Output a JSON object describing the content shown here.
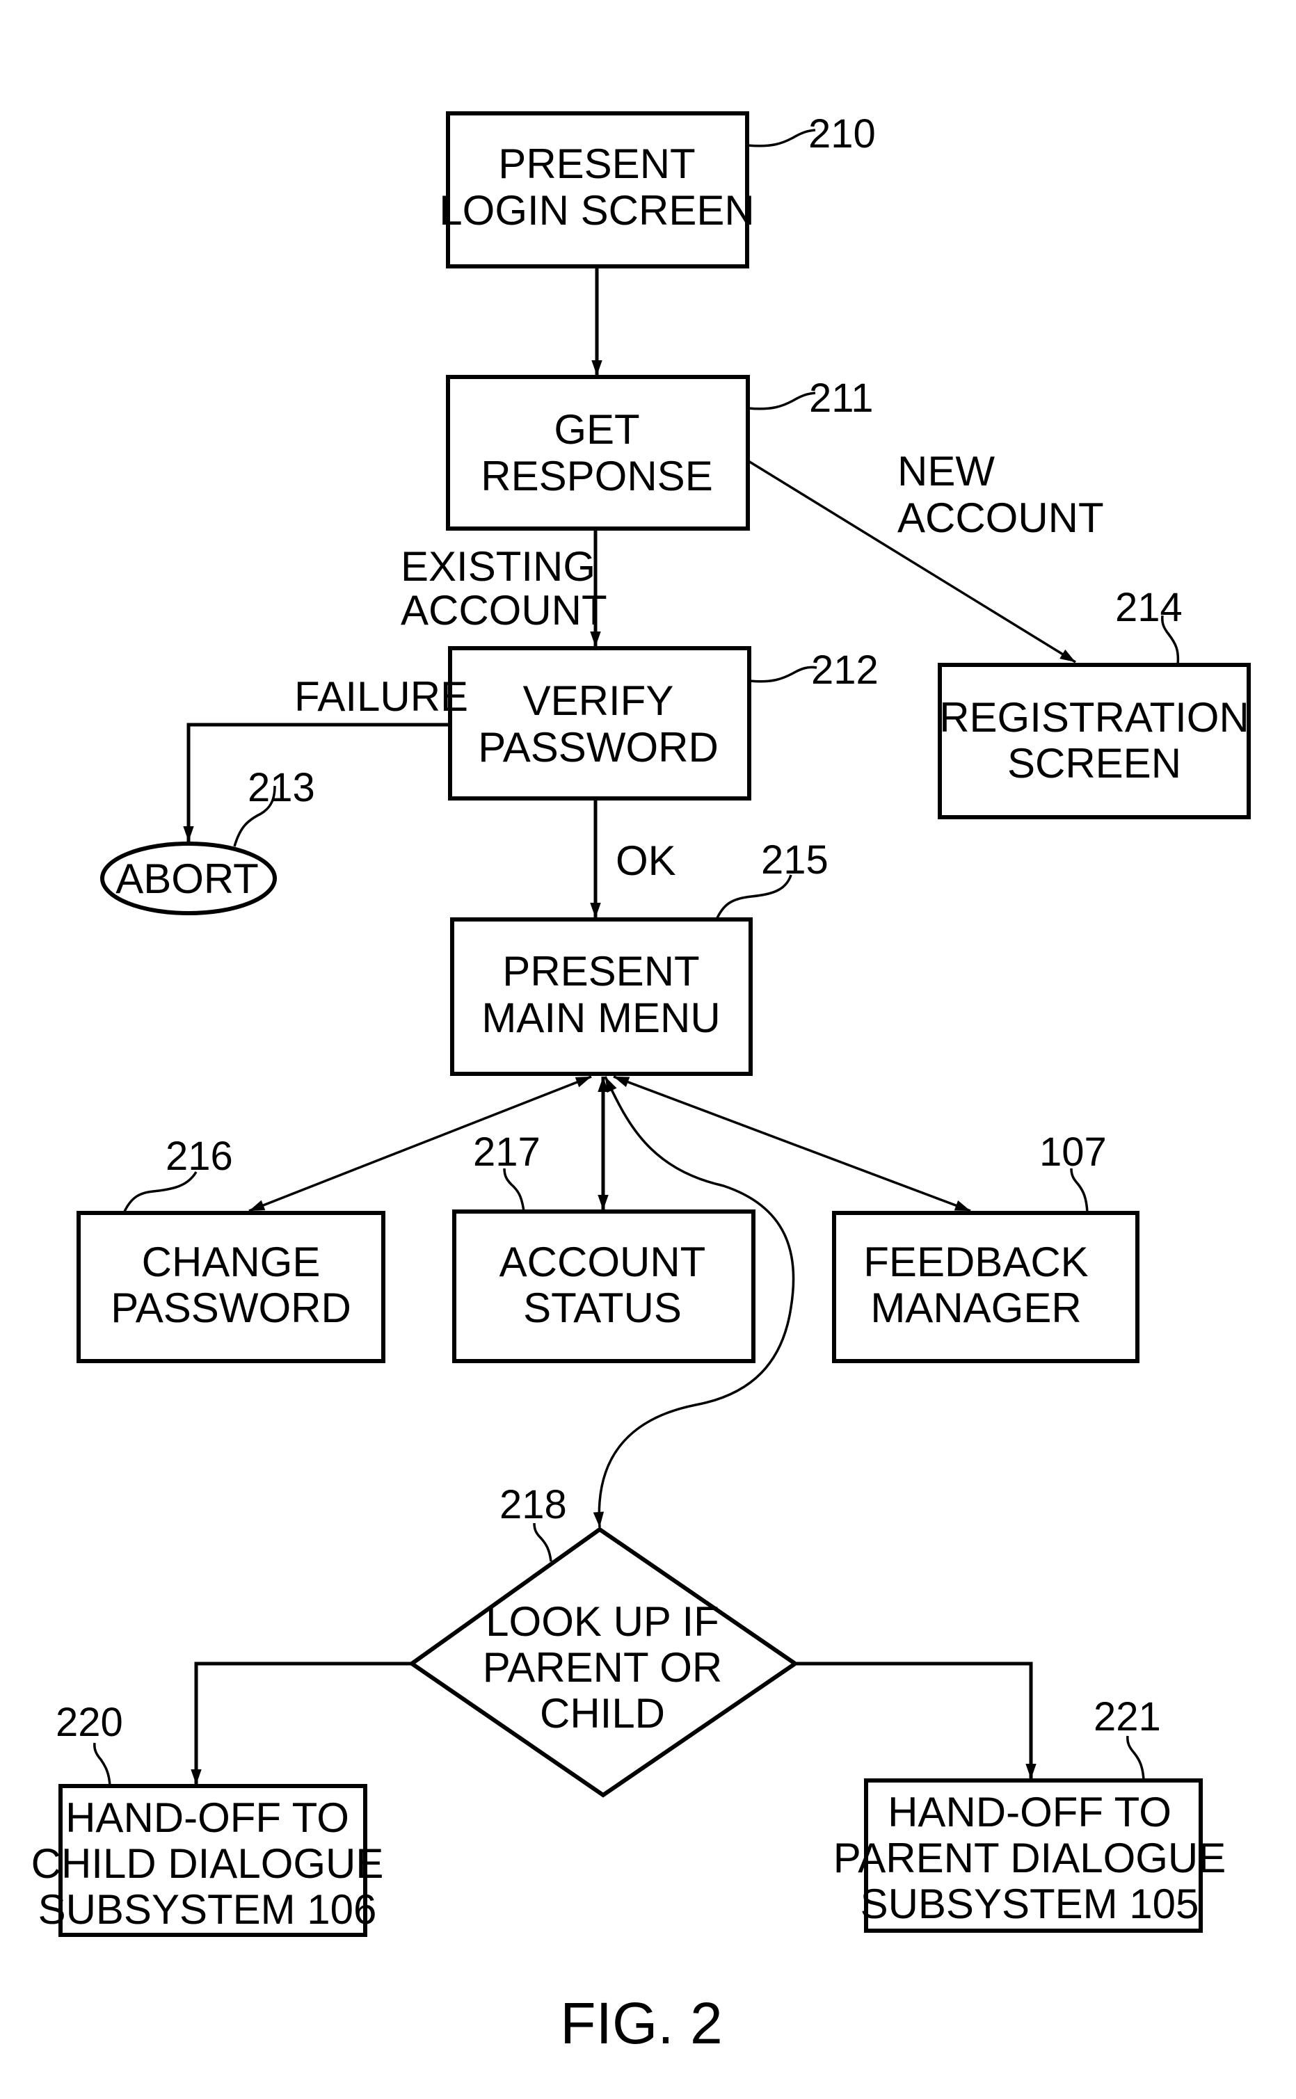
{
  "figure_title": "FIG. 2",
  "nodes": {
    "present_login": {
      "ref": "210",
      "lines": [
        "PRESENT",
        "LOGIN SCREEN"
      ]
    },
    "get_response": {
      "ref": "211",
      "lines": [
        "GET",
        "RESPONSE"
      ]
    },
    "verify_password": {
      "ref": "212",
      "lines": [
        "VERIFY",
        "PASSWORD"
      ]
    },
    "abort": {
      "ref": "213",
      "lines": [
        "ABORT"
      ]
    },
    "registration_screen": {
      "ref": "214",
      "lines": [
        "REGISTRATION",
        "SCREEN"
      ]
    },
    "present_main_menu": {
      "ref": "215",
      "lines": [
        "PRESENT",
        "MAIN MENU"
      ]
    },
    "change_password": {
      "ref": "216",
      "lines": [
        "CHANGE",
        "PASSWORD"
      ]
    },
    "account_status": {
      "ref": "217",
      "lines": [
        "ACCOUNT",
        "STATUS"
      ]
    },
    "feedback_manager": {
      "ref": "107",
      "lines": [
        "FEEDBACK",
        "MANAGER"
      ]
    },
    "lookup_parent_child": {
      "ref": "218",
      "lines": [
        "LOOK UP IF",
        "PARENT OR",
        "CHILD"
      ]
    },
    "handoff_child": {
      "ref": "220",
      "lines": [
        "HAND-OFF TO",
        "CHILD DIALOGUE",
        "SUBSYSTEM 106"
      ]
    },
    "handoff_parent": {
      "ref": "221",
      "lines": [
        "HAND-OFF TO",
        "PARENT DIALOGUE",
        "SUBSYSTEM 105"
      ]
    }
  },
  "edge_labels": {
    "new_account": [
      "NEW",
      "ACCOUNT"
    ],
    "existing_account": [
      "EXISTING",
      "ACCOUNT"
    ],
    "failure": "FAILURE",
    "ok": "OK"
  }
}
